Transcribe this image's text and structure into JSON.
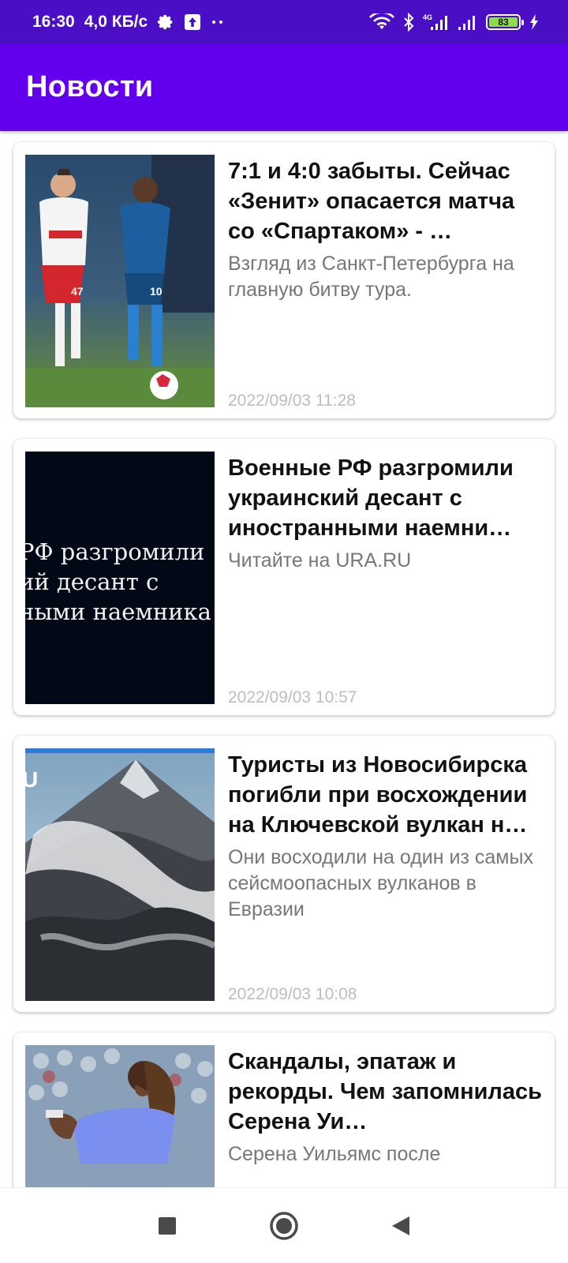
{
  "status_bar": {
    "time": "16:30",
    "speed": "4,0 КБ/с",
    "battery_level": "83",
    "icons": [
      "gear-icon",
      "upload-icon",
      "dots-icon",
      "wifi-icon",
      "bluetooth-icon",
      "signal-4g-icon",
      "signal-icon",
      "battery-icon",
      "charging-icon"
    ]
  },
  "app_bar": {
    "title": "Новости"
  },
  "news": [
    {
      "title": "7:1 и 4:0 забыты. Сейчас «Зенит» опасается матча со «Спартаком» - …",
      "description": "Взгляд из Санкт-Петербурга на главную битву тура.",
      "date": "2022/09/03 11:28",
      "image": "football-players-photo"
    },
    {
      "title": "Военные РФ разгромили украинский десант с иностранными наемни…",
      "description": "Читайте на URA.RU",
      "date": "2022/09/03 10:57",
      "image": "headline-text-image",
      "image_text_lines": [
        "РФ разгромили",
        "ий десант с",
        "ными наемника"
      ]
    },
    {
      "title": "Туристы из Новосибирска погибли при восхождении на Ключевской вулкан н…",
      "description": "Они восходили на один из самых сейсмоопасных вулканов в Евразии",
      "date": "2022/09/03 10:08",
      "image": "volcano-photo",
      "image_logo": "U"
    },
    {
      "title": "Скандалы, эпатаж и рекорды. Чем запомнилась Серена Уи…",
      "description": "Серена Уильямс после",
      "date": "",
      "image": "tennis-player-photo"
    }
  ],
  "nav_bar": {
    "buttons": [
      "recents-button",
      "home-button",
      "back-button"
    ]
  },
  "colors": {
    "status_bar": "#4a0fc4",
    "app_bar": "#6200ee",
    "date_text": "#bdbdbd",
    "desc_text": "#777777"
  }
}
